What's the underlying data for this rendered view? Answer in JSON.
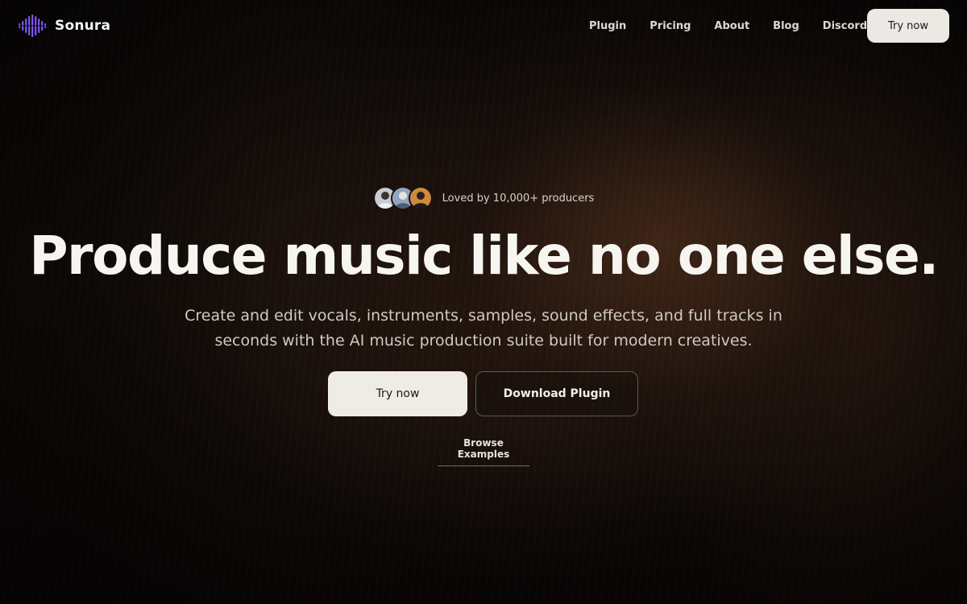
{
  "brand": {
    "name": "Sonura",
    "logo_icon": "waveform-logo-icon",
    "accent": "#7b4dff"
  },
  "nav": {
    "links": [
      "Plugin",
      "Pricing",
      "About",
      "Blog",
      "Discord"
    ],
    "cta_label": "Try now"
  },
  "hero": {
    "social_proof": "Loved by 10,000+ producers",
    "avatars": [
      "avatar-1",
      "avatar-2",
      "avatar-3"
    ],
    "headline": "Produce music like no one else.",
    "subhead": "Create and edit vocals, instruments, samples, sound effects, and full tracks in seconds with the AI music production suite built for modern creatives.",
    "primary_cta": "Try now",
    "secondary_cta": "Download Plugin",
    "browse_link": "Browse Examples"
  },
  "colors": {
    "background": "#0a0706",
    "button_light": "#eeece5",
    "text_primary": "#f7f5f0"
  }
}
